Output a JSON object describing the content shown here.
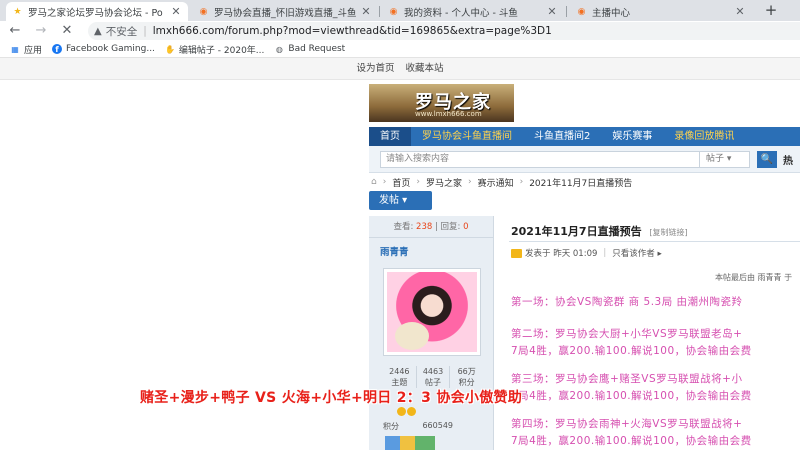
{
  "browser": {
    "tabs": [
      {
        "title": "罗马之家论坛罗马协会论坛 - Po",
        "active": true
      },
      {
        "title": "罗马协会直播_怀旧游戏直播_斗鱼",
        "active": false
      },
      {
        "title": "我的资料 - 个人中心 - 斗鱼",
        "active": false
      },
      {
        "title": "主播中心",
        "active": false
      }
    ],
    "new_tab": "+",
    "security_label": "不安全",
    "url": "lmxh666.com/forum.php?mod=viewthread&tid=169865&extra=page%3D1",
    "bookmarks": [
      {
        "label": "应用",
        "icon": "apps-grid-icon"
      },
      {
        "label": "Facebook Gaming...",
        "icon": "facebook-icon"
      },
      {
        "label": "编辑帖子 - 2020年...",
        "icon": "handshake-icon"
      },
      {
        "label": "Bad Request",
        "icon": "globe-icon"
      }
    ]
  },
  "page": {
    "top_links": [
      "设为首页",
      "收藏本站"
    ],
    "logo": {
      "title": "罗马之家",
      "url": "www.lmxh666.com"
    },
    "nav": [
      {
        "label": "首页",
        "style": "home"
      },
      {
        "label": "罗马协会斗鱼直播间",
        "style": "highlight"
      },
      {
        "label": "斗鱼直播间2",
        "style": ""
      },
      {
        "label": "娱乐赛事",
        "style": ""
      },
      {
        "label": "录像回放腾讯",
        "style": "highlight"
      }
    ],
    "search": {
      "placeholder": "请输入搜索内容",
      "scope": "帖子 ▾",
      "button": "🔍",
      "hot_label": "热"
    },
    "breadcrumb": [
      "首页",
      "罗马之家",
      "赛示通知",
      "2021年11月7日直播预告"
    ],
    "post_button": "发帖 ▾",
    "stats": {
      "views_label": "查看:",
      "views": "238",
      "sep": "|",
      "replies_label": "回复:",
      "replies": "0"
    },
    "author": {
      "name": "雨青青",
      "counts": [
        {
          "value": "2446",
          "label": "主题"
        },
        {
          "value": "4463",
          "label": "帖子"
        },
        {
          "value": "66万",
          "label": "积分"
        }
      ],
      "points_label": "积分",
      "points_value": "660549"
    },
    "post": {
      "title": "2021年11月7日直播预告",
      "copy_link": "[复制链接]",
      "published": "发表于 昨天 01:09",
      "separator": "|",
      "only_author": "只看该作者 ▸",
      "edit_note": "本帖最后由 雨青青 于",
      "lines": [
        "第一场：协会VS陶瓷群  商 5.3局  由潮州陶瓷羚",
        "第二场：罗马协会大厨+小华VS罗马联盟老岛+",
        "7局4胜，赢200.输100.解说100，协会输由会费",
        "第三场：罗马协会鹰+赌圣VS罗马联盟战将+小",
        "7局4胜，赢200.输100.解说100，协会输由会费",
        "第四场：罗马协会雨神+火海VS罗马联盟战将+",
        "7局4胜，赢200.输100.解说100，协会输由会费"
      ]
    },
    "overlay_caption": "赌圣+漫步+鸭子 VS 火海+小华+明日  2：3   协会小傲赞助"
  }
}
